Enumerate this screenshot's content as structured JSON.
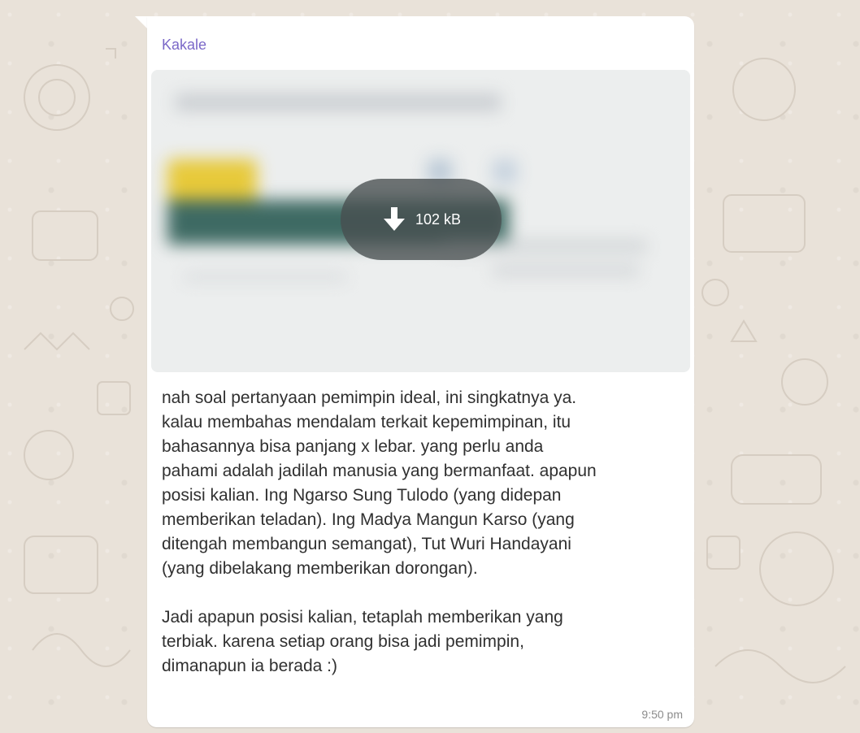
{
  "chat": {
    "background_color": "#e9e2d9",
    "bubble_color": "#ffffff"
  },
  "message": {
    "sender": "Kakale",
    "sender_color": "#7b68c8",
    "attachment": {
      "type": "image",
      "state": "not-downloaded",
      "size_label": "102 kB",
      "icon": "download-arrow-icon"
    },
    "text_paragraphs": [
      "nah soal pertanyaan pemimpin ideal, ini singkatnya ya.\nkalau membahas mendalam terkait kepemimpinan, itu\nbahasannya bisa panjang x lebar. yang perlu anda\npahami adalah jadilah manusia yang bermanfaat. apapun\nposisi kalian. Ing Ngarso Sung Tulodo (yang didepan\nmemberikan teladan). Ing Madya Mangun Karso (yang\nditengah membangun semangat), Tut Wuri Handayani\n(yang dibelakang memberikan dorongan).",
      "Jadi apapun posisi kalian, tetaplah memberikan yang\nterbiak. karena setiap orang bisa jadi pemimpin,\ndimanapun ia berada :)"
    ],
    "time": "9:50 pm"
  }
}
